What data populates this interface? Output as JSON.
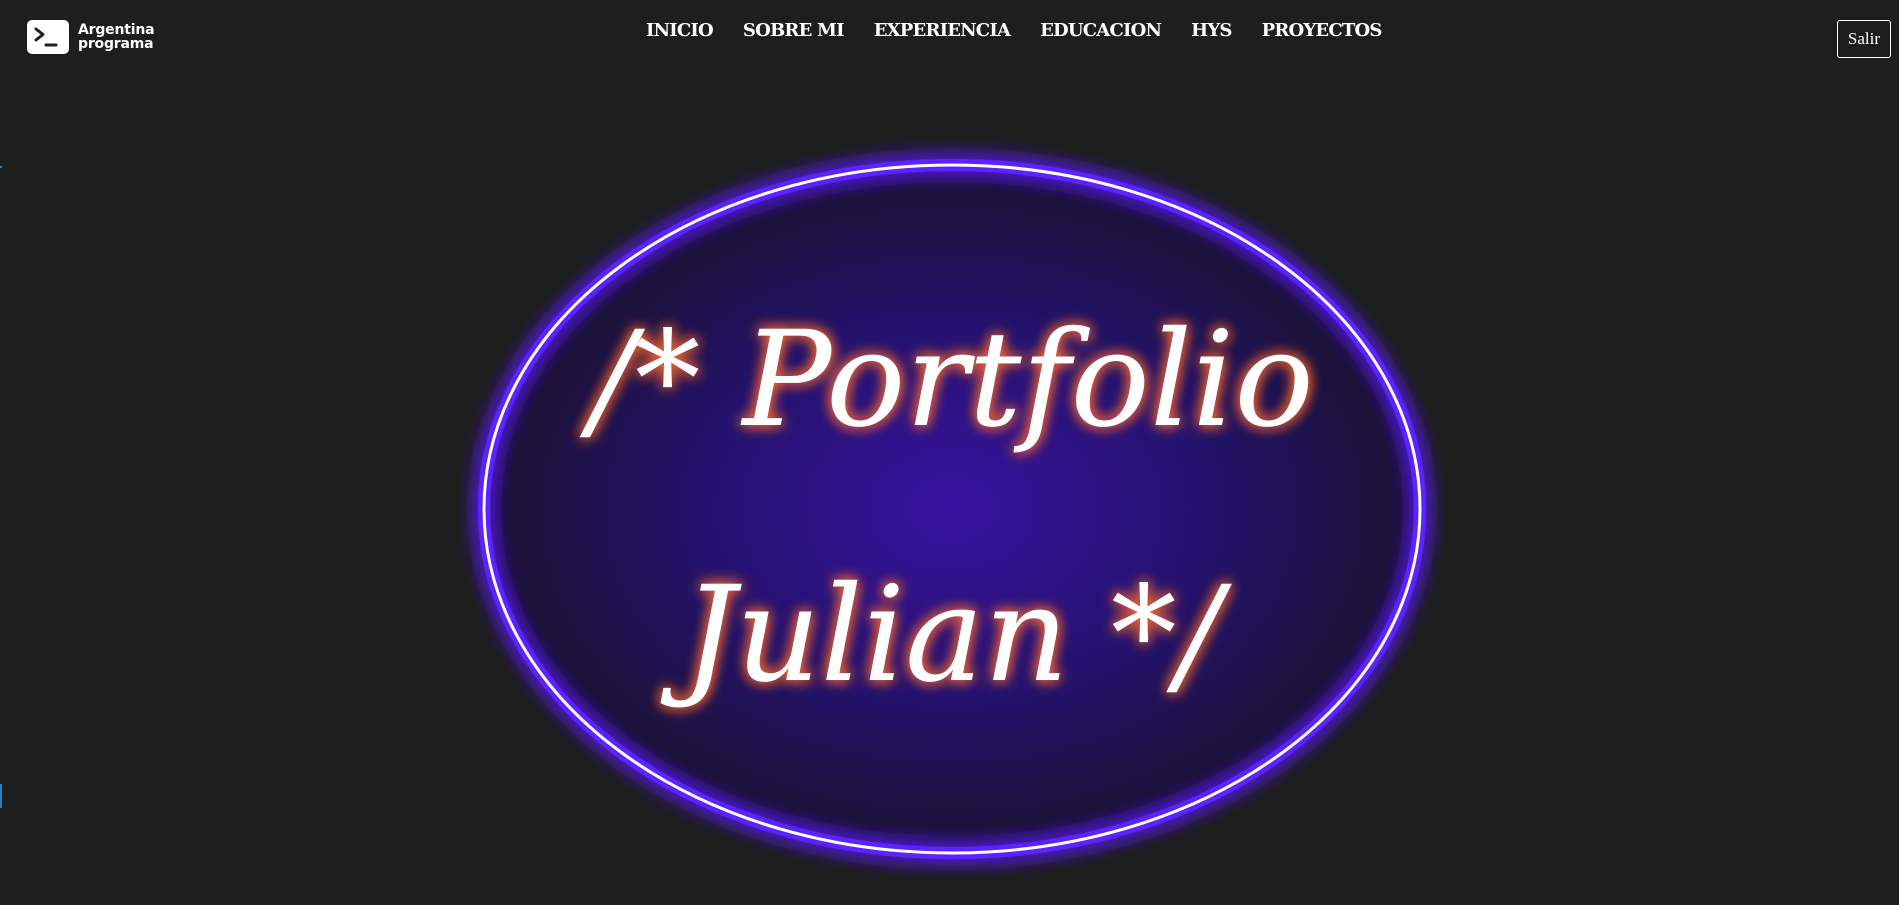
{
  "brand": {
    "line1": "Argentina",
    "line2": "programa",
    "icon": "terminal-prompt-icon"
  },
  "nav": {
    "items": [
      {
        "label": "INICIO"
      },
      {
        "label": "SOBRE MI"
      },
      {
        "label": "EXPERIENCIA"
      },
      {
        "label": "EDUCACION"
      },
      {
        "label": "HYS"
      },
      {
        "label": "PROYECTOS"
      }
    ],
    "logout_label": "Salir"
  },
  "hero": {
    "line1": "/* Portfolio",
    "line2": "Julian */"
  },
  "colors": {
    "background": "#1e1e1e",
    "neon_ring": "#6a2cff",
    "neon_text": "#ff7a3c",
    "text": "#ffffff"
  }
}
